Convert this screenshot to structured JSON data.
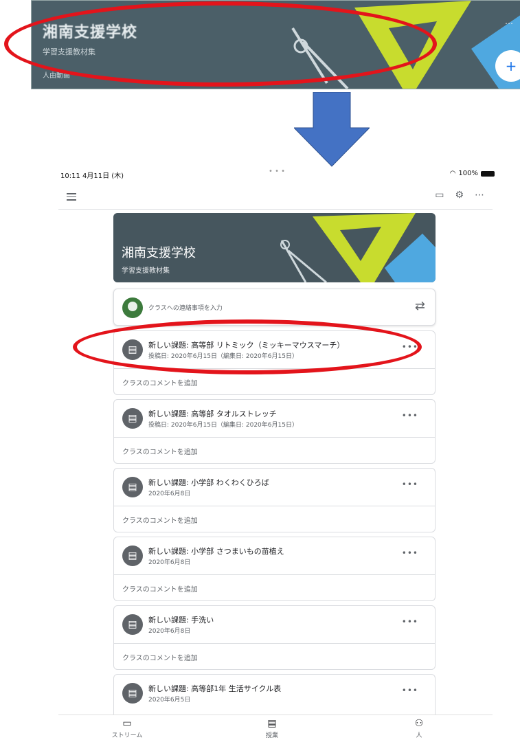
{
  "zoom_banner": {
    "title": "湘南支援学校",
    "subtitle": "学習支援教材集",
    "extra": "人由動画",
    "menu": "⋯",
    "fab": "+"
  },
  "statusbar": {
    "time": "10:11  4月11日 (木)",
    "dots": "• • •",
    "battery": "100%"
  },
  "appbar": {
    "video_icon": "video-icon",
    "settings_icon": "gear-icon",
    "more": "⋯"
  },
  "cover": {
    "title": "湘南支援学校",
    "subtitle": "学習支援教材集"
  },
  "announce": {
    "placeholder": "クラスへの連絡事項を入力"
  },
  "posts": [
    {
      "title": "新しい課題: 高等部 リトミック（ミッキーマウスマーチ）",
      "date": "投稿日: 2020年6月15日（編集日: 2020年6月15日）",
      "comment": "クラスのコメントを追加"
    },
    {
      "title": "新しい課題: 高等部 タオルストレッチ",
      "date": "投稿日: 2020年6月15日（編集日: 2020年6月15日）",
      "comment": "クラスのコメントを追加"
    },
    {
      "title": "新しい課題: 小学部 わくわくひろば",
      "date": "2020年6月8日",
      "comment": "クラスのコメントを追加"
    },
    {
      "title": "新しい課題: 小学部 さつまいもの苗植え",
      "date": "2020年6月8日",
      "comment": "クラスのコメントを追加"
    },
    {
      "title": "新しい課題: 手洗い",
      "date": "2020年6月8日",
      "comment": "クラスのコメントを追加"
    },
    {
      "title": "新しい課題: 高等部1年 生活サイクル表",
      "date": "2020年6月5日",
      "comment": ""
    }
  ],
  "bottomnav": {
    "stream": "ストリーム",
    "classwork": "授業",
    "people": "人"
  },
  "colors": {
    "banner": "#4b5f68",
    "ellipse": "#e3141b",
    "arrow": "#4472c4"
  }
}
